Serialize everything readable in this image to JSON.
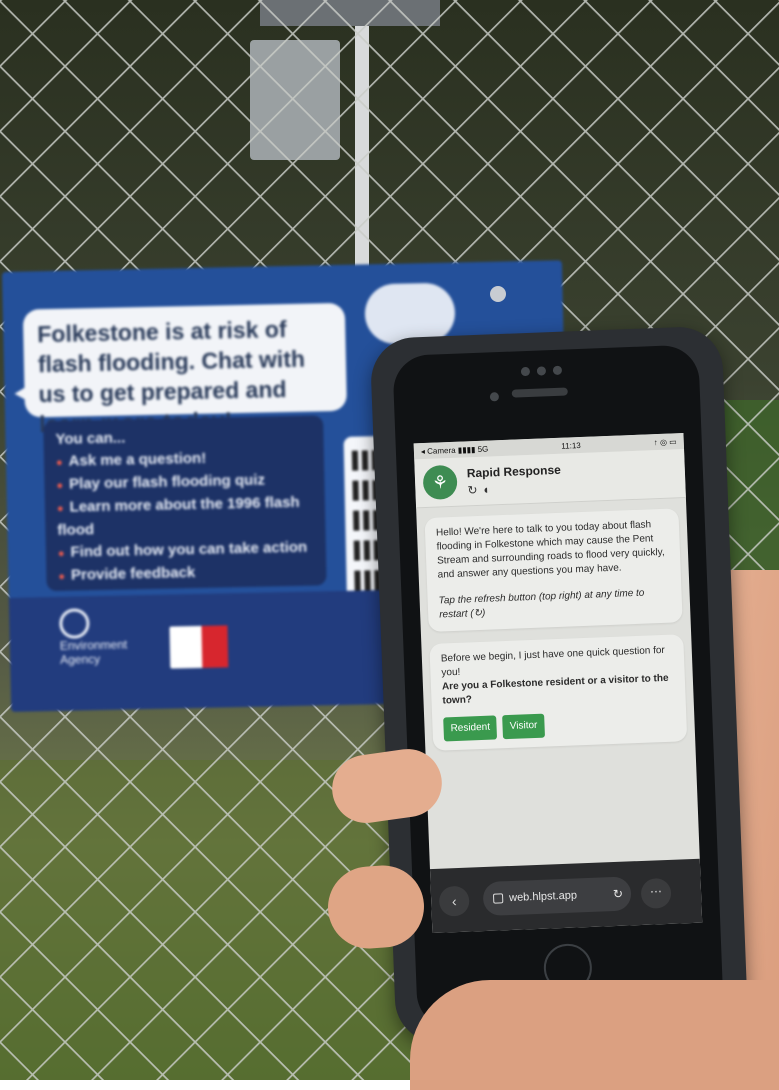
{
  "sign": {
    "headline": "Folkestone is at risk of flash flooding. Chat with us to get prepared and learn more today!",
    "you_can": "You can...",
    "items": [
      "Ask me a question!",
      "Play our flash flooding quiz",
      "Learn more about the 1996 flash flood",
      "Find out how you can take action",
      "Provide feedback"
    ],
    "agency": "Environment Agency"
  },
  "phone": {
    "status": {
      "left": "◂ Camera ▮▮▮▮ 5G",
      "time": "11:13",
      "right": "↑ ◎ ▭"
    },
    "app": {
      "title": "Rapid Response",
      "icons": "↻ ◐",
      "logo_icon": "tree-icon"
    },
    "messages": {
      "intro": "Hello! We're here to talk to you today about flash flooding in Folkestone which may cause the Pent Stream and surrounding roads to flood very quickly, and answer any questions you may have.",
      "hint": "Tap the refresh button (top right) at any time to restart (↻)",
      "pre_question": "Before we begin, I just have one quick question for you!",
      "question": "Are you a Folkestone resident or a visitor to the town?",
      "options": [
        "Resident",
        "Visitor"
      ]
    },
    "browser": {
      "url": "web.hlpst.app",
      "back": "‹",
      "more": "⋯",
      "reload": "↻"
    }
  },
  "colors": {
    "sign_blue": "#24509a",
    "button_green": "#3a9a4e",
    "logo_green": "#3e8c52"
  }
}
